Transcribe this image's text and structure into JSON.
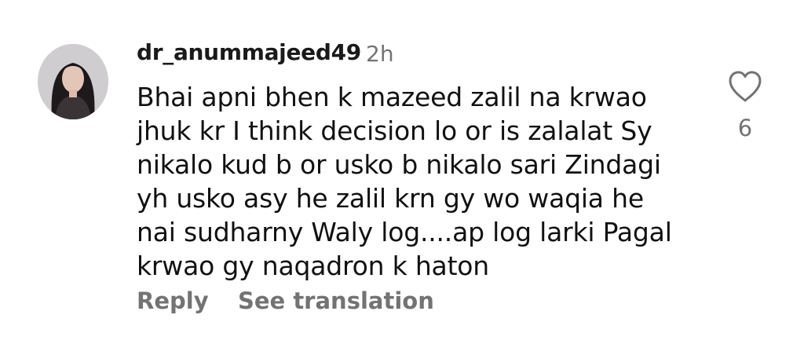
{
  "comment": {
    "username": "dr_anummajeed49",
    "timestamp": "2h",
    "text_lines": [
      "Bhai apni bhen k mazeed zalil na krwao",
      "jhuk kr I think decision lo or is zalalat Sy",
      "nikalo kud b or usko b nikalo sari Zindagi",
      "yh usko asy he zalil krn gy wo waqia he",
      "nai sudharny Waly log....ap log larki Pagal",
      "krwao gy naqadron k haton"
    ],
    "like_count": "6",
    "reply_label": "Reply",
    "translate_label": "See translation"
  },
  "icons": {
    "like": "heart-outline-icon",
    "avatar": "profile-photo"
  },
  "colors": {
    "primary_text": "#111111",
    "secondary_text": "#737373",
    "background": "#ffffff"
  }
}
